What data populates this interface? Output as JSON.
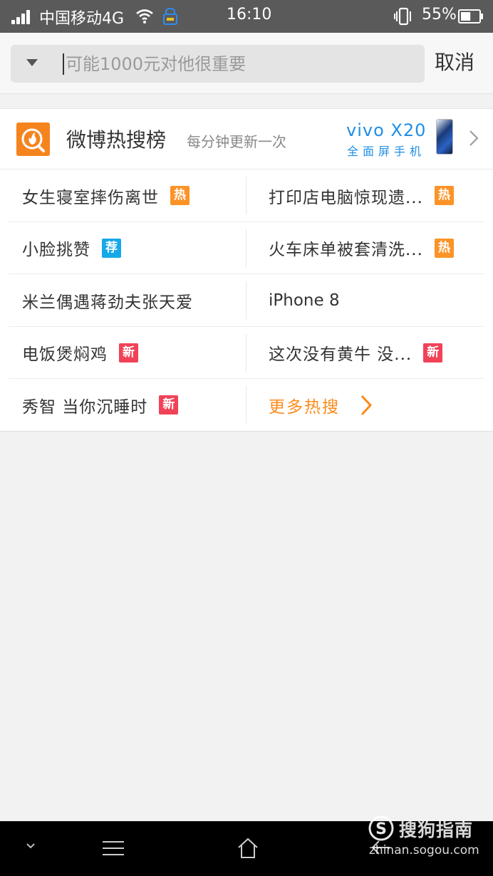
{
  "status_bar": {
    "carrier": "中国移动4G",
    "time": "16:10",
    "battery_percent": "55%",
    "battery_level": 0.55
  },
  "search": {
    "placeholder": "可能1000元对他很重要",
    "value": "",
    "cancel_label": "取消"
  },
  "hot_search": {
    "title": "微博热搜榜",
    "subtitle": "每分钟更新一次",
    "ad": {
      "brand": "vivo X20",
      "slogan": "全面屏手机"
    },
    "items": [
      {
        "left": {
          "text": "女生寝室摔伤离世",
          "badge": "热",
          "badge_type": "hot"
        },
        "right": {
          "text": "打印店电脑惊现遗...",
          "badge": "热",
          "badge_type": "hot"
        }
      },
      {
        "left": {
          "text": "小脸挑赞",
          "badge": "荐",
          "badge_type": "rec"
        },
        "right": {
          "text": "火车床单被套清洗...",
          "badge": "热",
          "badge_type": "hot"
        }
      },
      {
        "left": {
          "text": "米兰偶遇蒋劲夫张天爱",
          "badge": "",
          "badge_type": ""
        },
        "right": {
          "text": "iPhone 8",
          "badge": "",
          "badge_type": ""
        }
      },
      {
        "left": {
          "text": "电饭煲焖鸡",
          "badge": "新",
          "badge_type": "new"
        },
        "right": {
          "text": "这次没有黄牛 没...",
          "badge": "新",
          "badge_type": "new"
        }
      },
      {
        "left": {
          "text": "秀智 当你沉睡时",
          "badge": "新",
          "badge_type": "new"
        },
        "right": {
          "text": "更多热搜",
          "badge": "",
          "badge_type": "more"
        }
      }
    ],
    "colors": {
      "hot": "#fc9327",
      "rec": "#16a8e9",
      "new": "#f14257",
      "more": "#fc8a1b",
      "logo": "#f5841f"
    }
  },
  "watermark": {
    "title": "搜狗指南",
    "url": "zhinan.sogou.com"
  },
  "nav_bar": {
    "icons": [
      "chevron-down-icon",
      "menu-icon",
      "home-icon",
      "back-icon"
    ]
  }
}
